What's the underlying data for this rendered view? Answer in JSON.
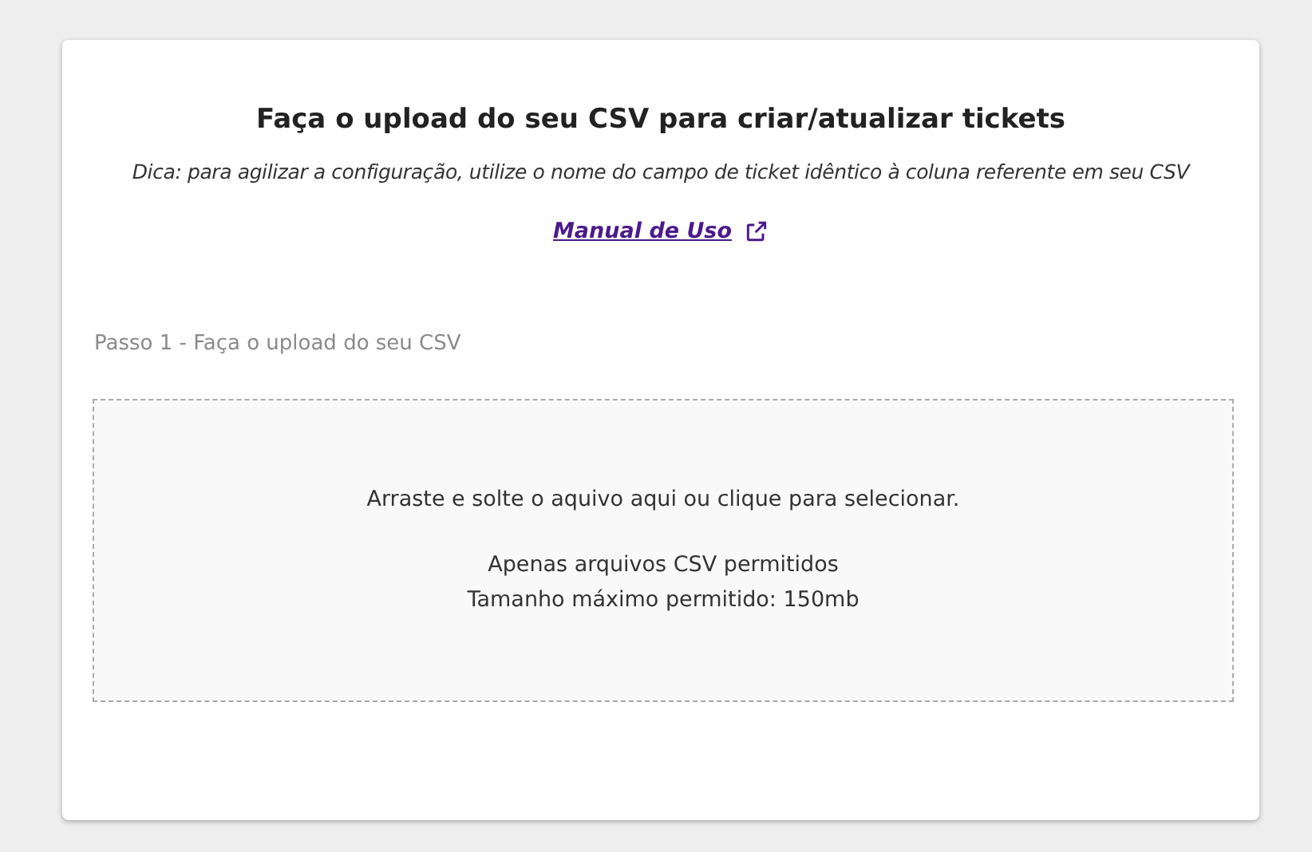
{
  "title": "Faça o upload do seu CSV para criar/atualizar tickets",
  "hint": "Dica: para agilizar a configuração, utilize o nome do campo de ticket idêntico à coluna referente em seu CSV",
  "manual_link": {
    "label": "Manual de Uso"
  },
  "step_label": "Passo 1 - Faça o upload do seu CSV",
  "dropzone": {
    "instruction": "Arraste e solte o aquivo aqui ou clique para selecionar.",
    "notes": [
      "Apenas arquivos CSV permitidos",
      "Tamanho máximo permitido: 150mb"
    ]
  }
}
